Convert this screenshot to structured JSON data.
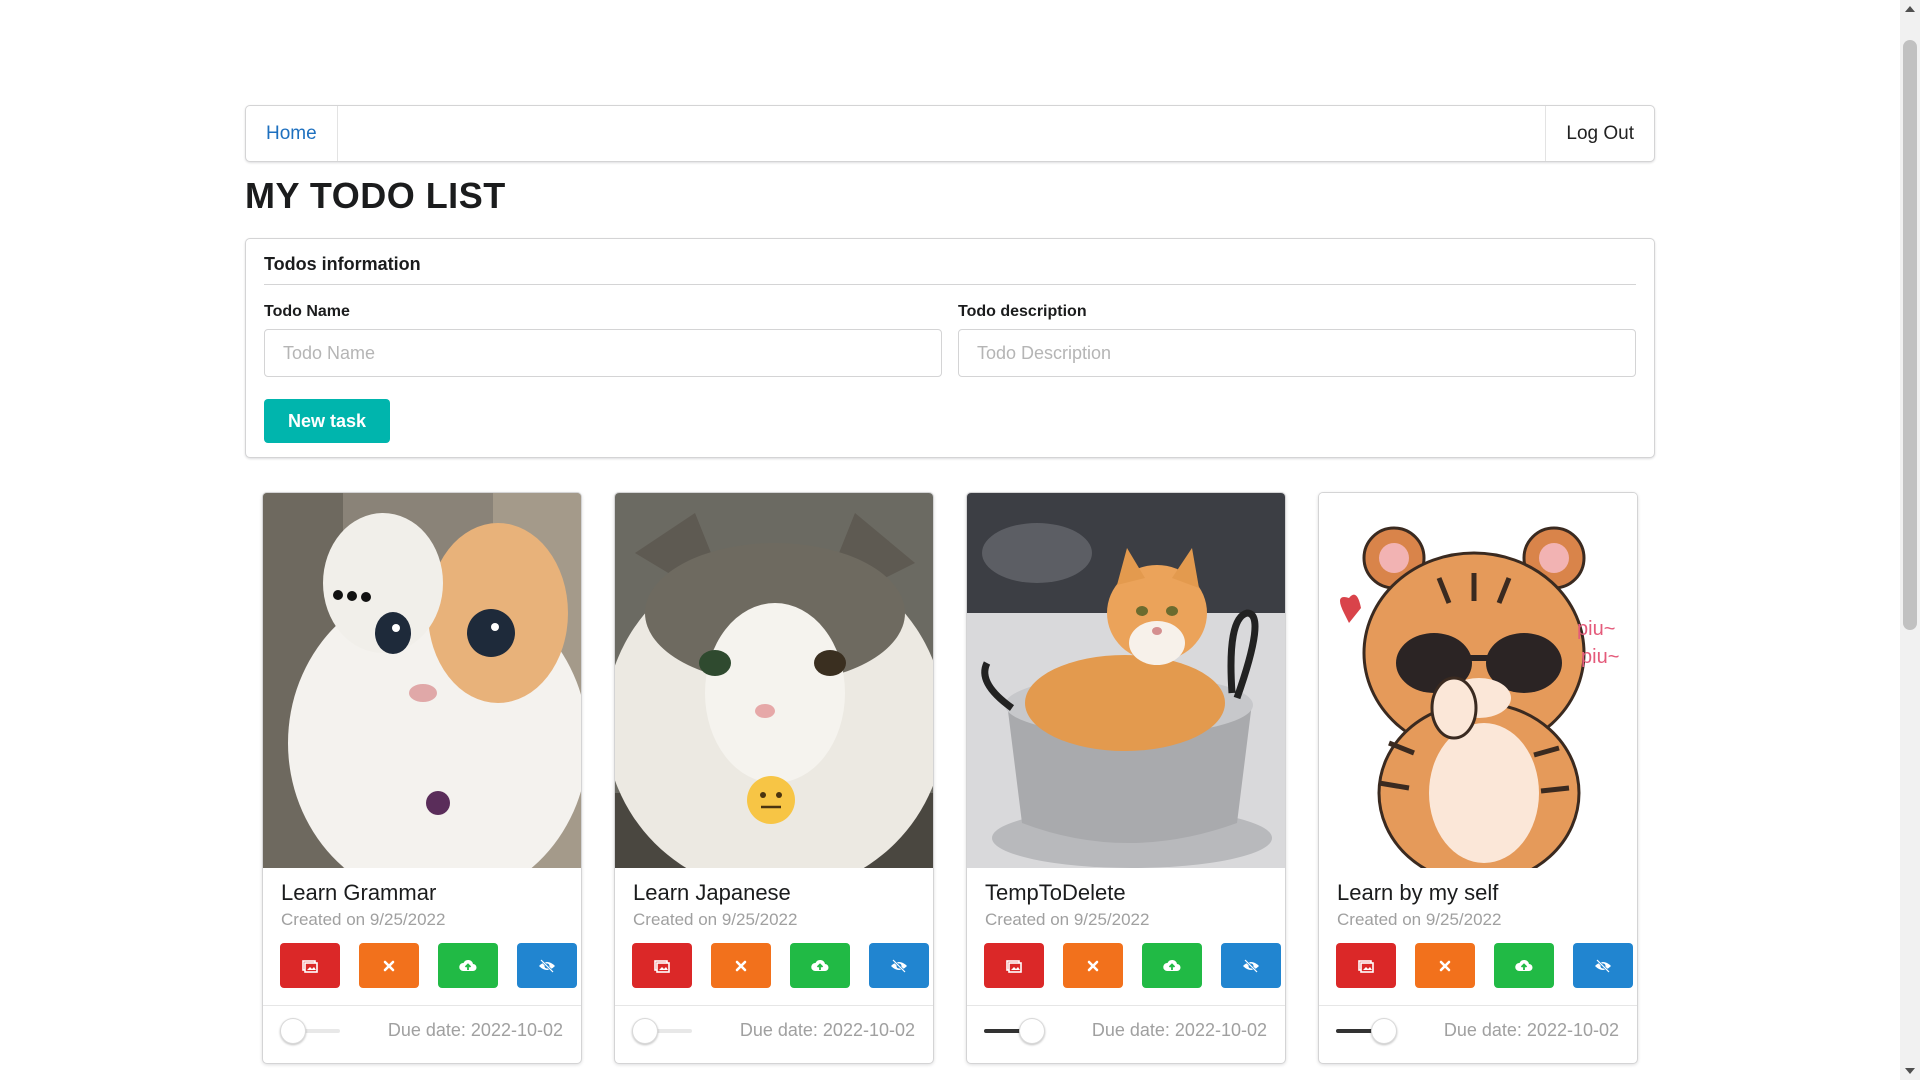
{
  "nav": {
    "home_label": "Home",
    "logout_label": "Log Out"
  },
  "page_title": "MY TODO LIST",
  "form": {
    "header": "Todos information",
    "name_label": "Todo Name",
    "name_placeholder": "Todo Name",
    "name_value": "",
    "description_label": "Todo description",
    "description_placeholder": "Todo Description",
    "description_value": "",
    "submit_label": "New task"
  },
  "todos": [
    {
      "title": "Learn Grammar",
      "created": "Created on 9/25/2022",
      "due": "Due date: 2022-10-02",
      "done": false,
      "image": "white-orange-cat-with-ellipsis"
    },
    {
      "title": "Learn Japanese",
      "created": "Created on 9/25/2022",
      "due": "Due date: 2022-10-02",
      "done": false,
      "image": "grey-white-cat-with-neutral-emoji"
    },
    {
      "title": "TempToDelete",
      "created": "Created on 9/25/2022",
      "due": "Due date: 2022-10-02",
      "done": true,
      "image": "orange-cat-in-pot"
    },
    {
      "title": "Learn by my self",
      "created": "Created on 9/25/2022",
      "due": "Due date: 2022-10-02",
      "done": true,
      "image": "cartoon-tiger-with-sunglasses",
      "image_text": [
        "piu~",
        "piu~"
      ]
    }
  ],
  "action_buttons": [
    {
      "name": "image-icon",
      "color": "#db2828"
    },
    {
      "name": "close-icon",
      "color": "#f2711c"
    },
    {
      "name": "cloud-upload-icon",
      "color": "#21ba45"
    },
    {
      "name": "eye-slash-icon",
      "color": "#2185d0"
    }
  ]
}
